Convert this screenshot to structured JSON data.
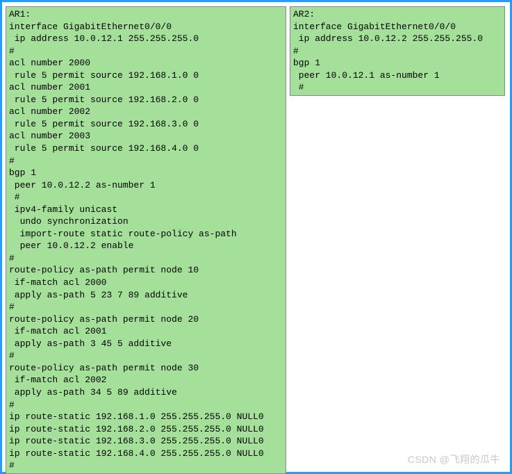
{
  "ar1": {
    "lines": [
      "AR1:",
      "interface GigabitEthernet0/0/0",
      " ip address 10.0.12.1 255.255.255.0",
      "#",
      "acl number 2000",
      " rule 5 permit source 192.168.1.0 0",
      "acl number 2001",
      " rule 5 permit source 192.168.2.0 0",
      "acl number 2002",
      " rule 5 permit source 192.168.3.0 0",
      "acl number 2003",
      " rule 5 permit source 192.168.4.0 0",
      "#",
      "bgp 1",
      " peer 10.0.12.2 as-number 1",
      " #",
      " ipv4-family unicast",
      "  undo synchronization",
      "  import-route static route-policy as-path",
      "  peer 10.0.12.2 enable",
      "#",
      "route-policy as-path permit node 10",
      " if-match acl 2000",
      " apply as-path 5 23 7 89 additive",
      "#",
      "route-policy as-path permit node 20",
      " if-match acl 2001",
      " apply as-path 3 45 5 additive",
      "#",
      "route-policy as-path permit node 30",
      " if-match acl 2002",
      " apply as-path 34 5 89 additive",
      "#",
      "ip route-static 192.168.1.0 255.255.255.0 NULL0",
      "ip route-static 192.168.2.0 255.255.255.0 NULL0",
      "ip route-static 192.168.3.0 255.255.255.0 NULL0",
      "ip route-static 192.168.4.0 255.255.255.0 NULL0",
      "#"
    ]
  },
  "ar2": {
    "lines": [
      "AR2:",
      "interface GigabitEthernet0/0/0",
      " ip address 10.0.12.2 255.255.255.0",
      "#",
      "bgp 1",
      " peer 10.0.12.1 as-number 1",
      " #"
    ]
  },
  "watermark": "CSDN @飞翔的瓜牛"
}
